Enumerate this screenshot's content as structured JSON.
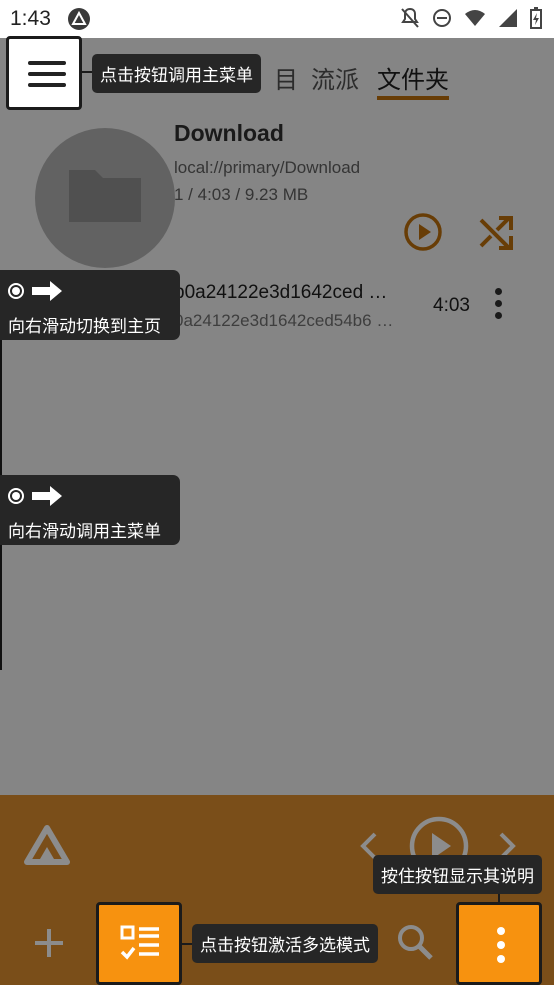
{
  "status_bar": {
    "time": "1:43"
  },
  "tabs": [
    {
      "label": "目",
      "active": false
    },
    {
      "label": "流派",
      "active": false
    },
    {
      "label": "文件夹",
      "active": true
    }
  ],
  "folder": {
    "title": "Download",
    "path": "local://primary/Download",
    "stats": "1 / 4:03 / 9.23 MB"
  },
  "track": {
    "name": "b0a24122e3d1642ced  …",
    "subtitle": "0a24122e3d1642ced54b6 …",
    "duration": "4:03"
  },
  "tooltips": {
    "menu": "点击按钮调用主菜单",
    "swipe_home": "向右滑动切换到主页",
    "swipe_menu": "向右滑动调用主菜单",
    "multiselect": "点击按钮激活多选模式",
    "more": "按住按钮显示其说明"
  },
  "colors": {
    "accent": "#c8750c",
    "bottom_bar": "#7a4e19",
    "highlight_orange": "#f7920f",
    "tooltip_bg": "#262626"
  },
  "icons": {
    "menu": "hamburger-icon",
    "play": "play-circle-icon",
    "shuffle": "shuffle-icon",
    "more": "vertical-dots-icon",
    "multiselect": "checklist-icon",
    "search": "search-icon",
    "add": "plus-icon",
    "logo": "app-logo-icon"
  }
}
